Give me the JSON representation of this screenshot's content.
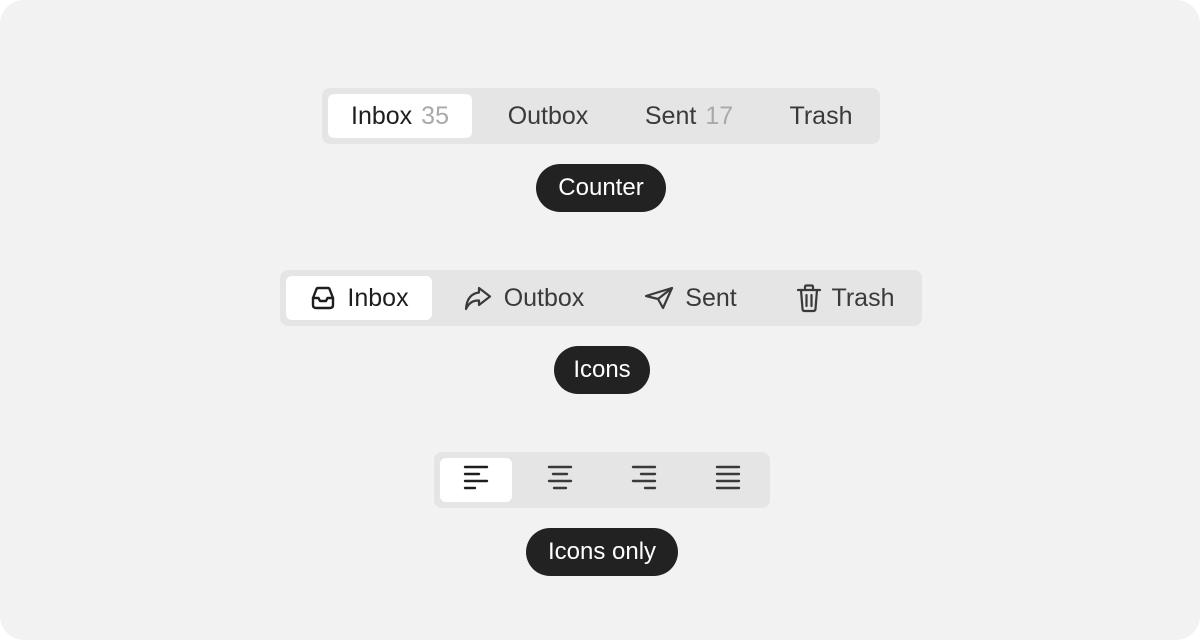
{
  "counter_tabs": [
    {
      "label": "Inbox",
      "count": "35"
    },
    {
      "label": "Outbox",
      "count": ""
    },
    {
      "label": "Sent",
      "count": "17"
    },
    {
      "label": "Trash",
      "count": ""
    }
  ],
  "icon_tabs": [
    {
      "label": "Inbox",
      "icon": "inbox-tray-icon"
    },
    {
      "label": "Outbox",
      "icon": "forward-arrow-icon"
    },
    {
      "label": "Sent",
      "icon": "paper-plane-icon"
    },
    {
      "label": "Trash",
      "icon": "trash-can-icon"
    }
  ],
  "icon_only_tabs": [
    {
      "icon": "align-left-icon"
    },
    {
      "icon": "align-center-icon"
    },
    {
      "icon": "align-right-icon"
    },
    {
      "icon": "align-justify-icon"
    }
  ],
  "captions": {
    "counter": "Counter",
    "icons": "Icons",
    "icons_only": "Icons only"
  },
  "selected": {
    "counter": "Inbox",
    "icons": "Inbox",
    "icons_only": "align-left"
  },
  "colors": {
    "background": "#f2f2f2",
    "segment_track": "#e5e5e5",
    "selected_item": "#ffffff",
    "caption_pill": "#222222",
    "counter_text": "#a9a9a9"
  }
}
